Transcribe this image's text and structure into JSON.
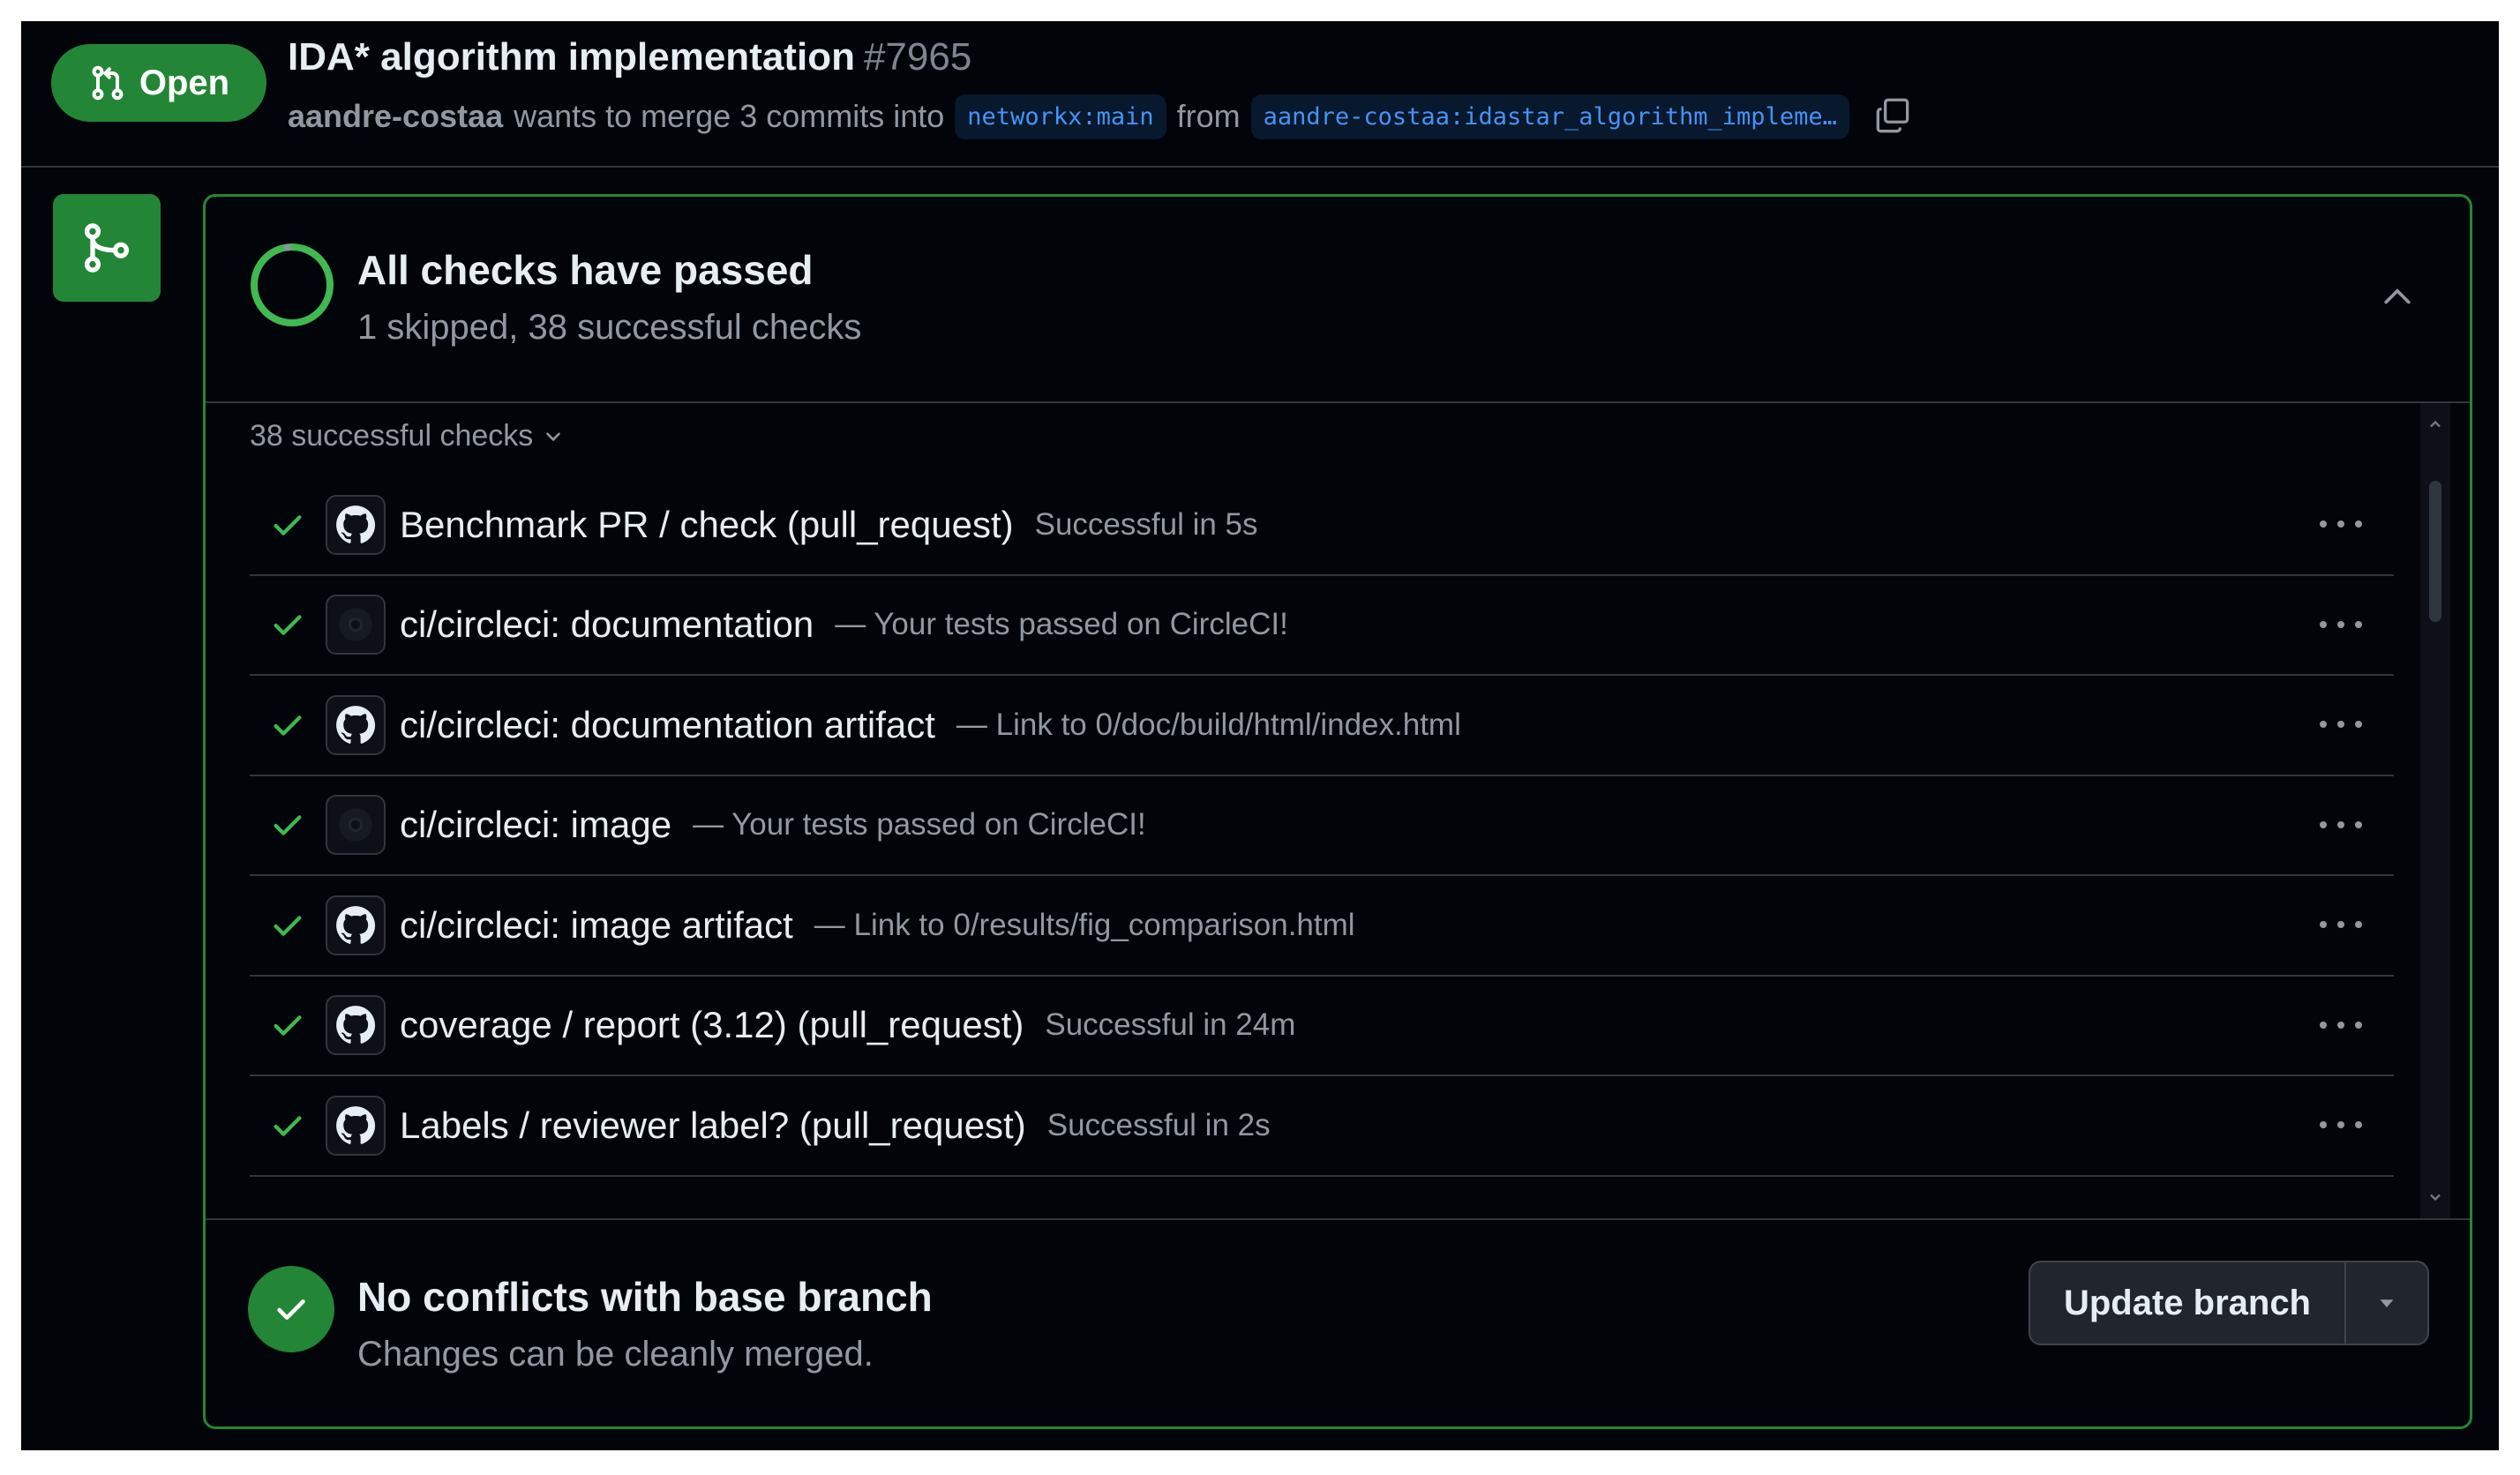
{
  "pr": {
    "state": "Open",
    "title": "IDA* algorithm implementation",
    "number": "#7965",
    "author": "aandre-costaa",
    "merge_text": "wants to merge 3 commits into",
    "base_branch": "networkx:main",
    "from_text": "from",
    "head_branch": "aandre-costaa:idastar_algorithm_impleme…"
  },
  "checks": {
    "title": "All checks have passed",
    "subtitle": "1 skipped, 38 successful checks",
    "group_label": "38 successful checks",
    "items": [
      {
        "name": "Benchmark PR / check (pull_request)",
        "desc": "Successful in 5s",
        "icon": "github-icon"
      },
      {
        "name": "ci/circleci: documentation",
        "desc": "— Your tests passed on CircleCI!",
        "icon": "circleci-icon"
      },
      {
        "name": "ci/circleci: documentation artifact",
        "desc": "— Link to 0/doc/build/html/index.html",
        "icon": "github-icon"
      },
      {
        "name": "ci/circleci: image",
        "desc": "— Your tests passed on CircleCI!",
        "icon": "circleci-icon"
      },
      {
        "name": "ci/circleci: image artifact",
        "desc": "— Link to 0/results/fig_comparison.html",
        "icon": "github-icon"
      },
      {
        "name": "coverage / report (3.12) (pull_request)",
        "desc": "Successful in 24m",
        "icon": "github-icon"
      },
      {
        "name": "Labels / reviewer label? (pull_request)",
        "desc": "Successful in 2s",
        "icon": "github-icon"
      }
    ]
  },
  "merge": {
    "title": "No conflicts with base branch",
    "subtitle": "Changes can be cleanly merged.",
    "update_label": "Update branch"
  },
  "colors": {
    "success": "#238636",
    "check_green": "#3fb950",
    "link_blue": "#4493f8",
    "background": "#010409"
  }
}
